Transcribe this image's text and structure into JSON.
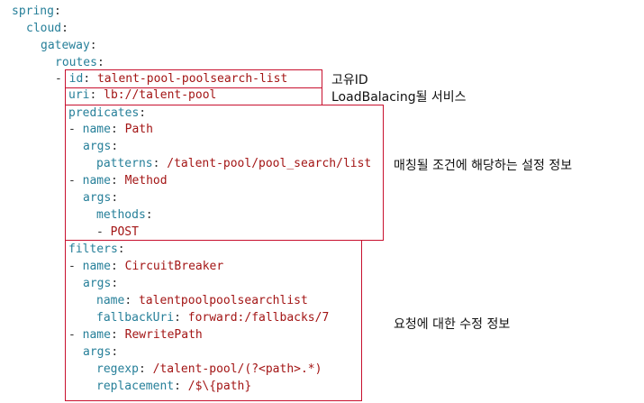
{
  "code": {
    "lines": [
      {
        "key": "spring",
        "sep": ":",
        "value": ""
      },
      {
        "key": "cloud",
        "sep": ":",
        "value": ""
      },
      {
        "key": "gateway",
        "sep": ":",
        "value": ""
      },
      {
        "key": "routes",
        "sep": ":",
        "value": ""
      },
      {
        "prefix": "- ",
        "key": "id",
        "sep": ": ",
        "value": "talent-pool-poolsearch-list"
      },
      {
        "key": "uri",
        "sep": ": ",
        "value": "lb://talent-pool"
      },
      {
        "key": "predicates",
        "sep": ":",
        "value": ""
      },
      {
        "prefix": "- ",
        "key": "name",
        "sep": ": ",
        "value": "Path"
      },
      {
        "key": "args",
        "sep": ":",
        "value": ""
      },
      {
        "key": "patterns",
        "sep": ": ",
        "value": "/talent-pool/pool_search/list"
      },
      {
        "prefix": "- ",
        "key": "name",
        "sep": ": ",
        "value": "Method"
      },
      {
        "key": "args",
        "sep": ":",
        "value": ""
      },
      {
        "key": "methods",
        "sep": ":",
        "value": ""
      },
      {
        "prefix": "- ",
        "key": "",
        "sep": "",
        "value": "POST"
      },
      {
        "key": "filters",
        "sep": ":",
        "value": ""
      },
      {
        "prefix": "- ",
        "key": "name",
        "sep": ": ",
        "value": "CircuitBreaker"
      },
      {
        "key": "args",
        "sep": ":",
        "value": ""
      },
      {
        "key": "name",
        "sep": ": ",
        "value": "talentpoolpoolsearchlist"
      },
      {
        "key": "fallbackUri",
        "sep": ": ",
        "value": "forward:/fallbacks/7"
      },
      {
        "prefix": "- ",
        "key": "name",
        "sep": ": ",
        "value": "RewritePath"
      },
      {
        "key": "args",
        "sep": ":",
        "value": ""
      },
      {
        "key": "regexp",
        "sep": ": ",
        "value": "/talent-pool/(?<path>.*)"
      },
      {
        "key": "replacement",
        "sep": ": ",
        "value": "/$\\{path}"
      }
    ]
  },
  "annotations": {
    "id": "고유ID",
    "uri": "LoadBalacing될 서비스",
    "predicates": "매칭될 조건에 해당하는 설정 정보",
    "filters": "요청에 대한 수정 정보"
  },
  "colors": {
    "key": "#267f99",
    "value": "#a31515",
    "box_border": "#c8102e",
    "annotation_text": "#111111"
  }
}
